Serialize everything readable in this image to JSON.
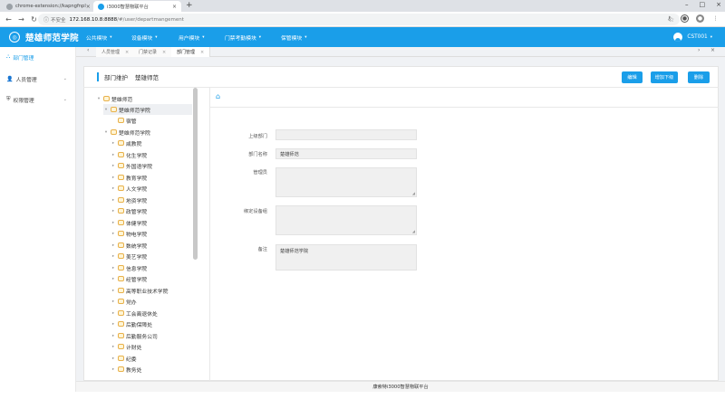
{
  "browser": {
    "tabs": [
      {
        "title": "chrome-extension://kapngfnpl",
        "active": false
      },
      {
        "title": "i3000智慧物联平台",
        "active": true
      }
    ],
    "new_tab": "+",
    "security": "不安全",
    "url_host": "172.168.10.8:8888",
    "url_path": "/#/user/departmangement"
  },
  "header": {
    "school_name": "楚雄师范学院",
    "menu": [
      {
        "label": "公共模块"
      },
      {
        "label": "设备模块"
      },
      {
        "label": "用户模块"
      },
      {
        "label": "门禁考勤模块"
      },
      {
        "label": "保管模块"
      }
    ],
    "user": "CST001"
  },
  "sidebar": {
    "items": [
      {
        "label": "部门管理",
        "active": true
      },
      {
        "label": "人员管理",
        "active": false
      },
      {
        "label": "权限管理",
        "active": false
      }
    ]
  },
  "page_tabs": [
    {
      "label": "人员管理"
    },
    {
      "label": "门禁记录"
    },
    {
      "label": "部门管理"
    }
  ],
  "breadcrumb": {
    "section": "部门维护",
    "current": "楚雄师范"
  },
  "actions": {
    "edit": "编辑",
    "add_child": "增加下级",
    "delete": "删除"
  },
  "tree": [
    {
      "label": "楚雄师范",
      "level": 0
    },
    {
      "label": "楚雄师范学院",
      "level": 1
    },
    {
      "label": "宿管",
      "level": 2
    },
    {
      "label": "楚雄师范学院",
      "level": 1
    },
    {
      "label": "咸教院",
      "level": 2
    },
    {
      "label": "化生学院",
      "level": 2
    },
    {
      "label": "外国语学院",
      "level": 2
    },
    {
      "label": "教育学院",
      "level": 2
    },
    {
      "label": "人文学院",
      "level": 2
    },
    {
      "label": "地资学院",
      "level": 2
    },
    {
      "label": "政管学院",
      "level": 2
    },
    {
      "label": "体健学院",
      "level": 2
    },
    {
      "label": "物电学院",
      "level": 2
    },
    {
      "label": "数统学院",
      "level": 2
    },
    {
      "label": "美艺学院",
      "level": 2
    },
    {
      "label": "信息学院",
      "level": 2
    },
    {
      "label": "经管学院",
      "level": 2
    },
    {
      "label": "高等职业技术学院",
      "level": 2
    },
    {
      "label": "党办",
      "level": 2
    },
    {
      "label": "工会离退休处",
      "level": 2
    },
    {
      "label": "后勤保障处",
      "level": 2
    },
    {
      "label": "后勤服务公司",
      "level": 2
    },
    {
      "label": "计财处",
      "level": 2
    },
    {
      "label": "纪委",
      "level": 2
    },
    {
      "label": "教务处",
      "level": 2
    }
  ],
  "form": {
    "parent_label": "上级部门",
    "parent_value": "",
    "name_label": "部门名称",
    "name_value": "楚雄师范",
    "admin_label": "管理员",
    "admin_value": "",
    "device_label": "绑定设备组",
    "device_value": "",
    "note_label": "备注",
    "note_value": "楚雄师范学院"
  },
  "footer": "康索特i3000智慧物联平台",
  "colors": {
    "accent": "#1a9ee9"
  }
}
